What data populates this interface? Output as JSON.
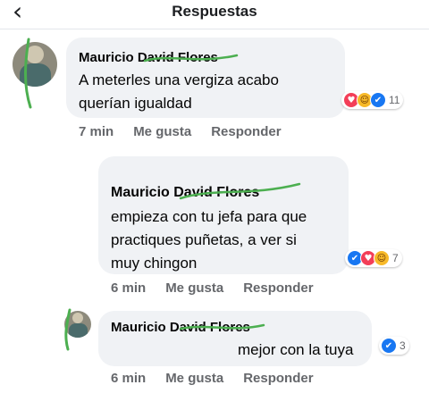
{
  "header": {
    "back_icon": "chevron-left-icon",
    "title": "Respuestas"
  },
  "comments": [
    {
      "author": "Mauricio David Flores",
      "text": "A meterles una vergiza acabo\nquerían igualdad",
      "time": "7 min",
      "like_label": "Me gusta",
      "reply_label": "Responder",
      "reactions": [
        "love",
        "haha",
        "like"
      ],
      "reaction_count": "11"
    },
    {
      "author": "Mauricio David Flores",
      "text": "empieza con tu jefa para que\npractiques puñetas, a ver si\nmuy chingon",
      "time": "6 min",
      "like_label": "Me gusta",
      "reply_label": "Responder",
      "reactions": [
        "like",
        "love",
        "haha"
      ],
      "reaction_count": "7"
    },
    {
      "author": "Mauricio David Flores",
      "text": "mejor con la tuya",
      "time": "6 min",
      "like_label": "Me gusta",
      "reply_label": "Responder",
      "reactions": [
        "like"
      ],
      "reaction_count": "3"
    }
  ],
  "colors": {
    "bubble": "#f0f2f5",
    "scribble": "#4caf50",
    "like": "#1877f2",
    "love": "#f33e58",
    "haha": "#f7b928"
  }
}
